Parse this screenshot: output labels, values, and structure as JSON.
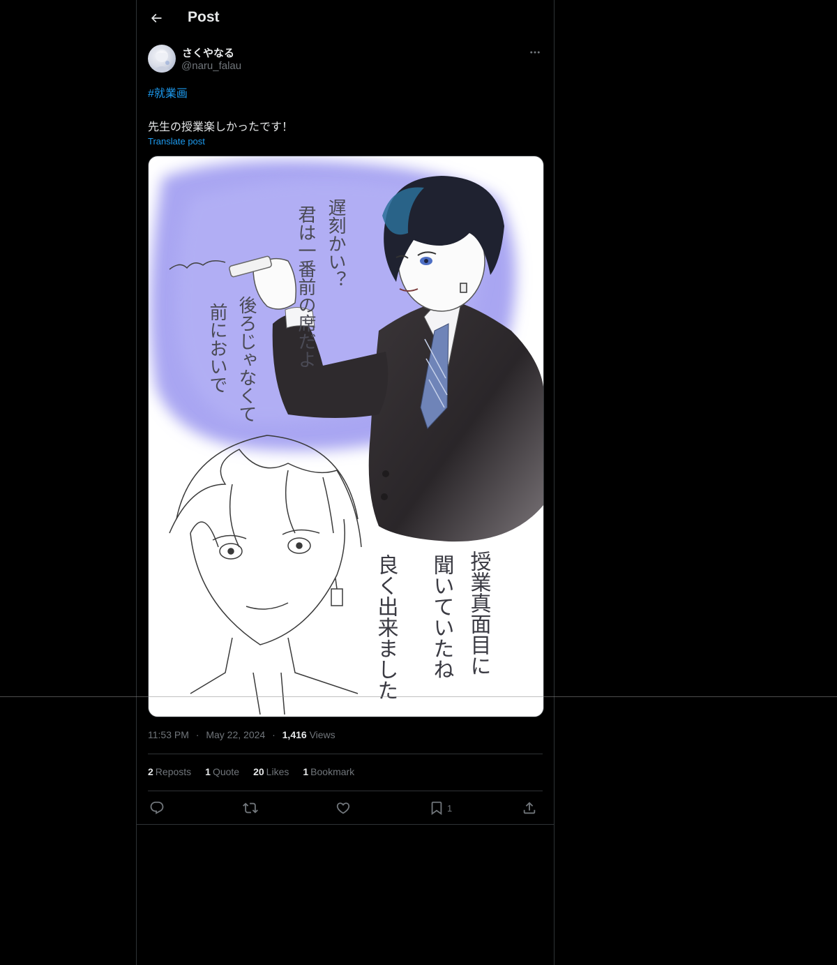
{
  "header": {
    "title": "Post",
    "back_icon": "arrow-left-icon"
  },
  "author": {
    "display_name": "さくやなる",
    "handle": "@naru_falau"
  },
  "post": {
    "hashtag": "#就業画",
    "text": "先生の授業楽しかったです！",
    "translate_label": "Translate post",
    "image_text": {
      "column_1": "遅刻かい？",
      "column_2": "君は一番前の席だよ",
      "column_3": "後ろじゃなくて",
      "column_4": "前においで",
      "column_5": "授業真面目に",
      "column_6": "聞いていたね",
      "column_7": "良く出来ました"
    }
  },
  "meta": {
    "time": "11:53 PM",
    "separator": "·",
    "date": "May 22, 2024",
    "views_count": "1,416",
    "views_label": "Views"
  },
  "stats": {
    "reposts_count": "2",
    "reposts_label": "Reposts",
    "quotes_count": "1",
    "quotes_label": "Quote",
    "likes_count": "20",
    "likes_label": "Likes",
    "bookmarks_count": "1",
    "bookmarks_label": "Bookmark"
  },
  "actions": {
    "reply_icon": "reply-icon",
    "repost_icon": "repost-icon",
    "like_icon": "heart-icon",
    "bookmark_icon": "bookmark-icon",
    "bookmark_count": "1",
    "share_icon": "share-icon"
  },
  "colors": {
    "background": "#000000",
    "text": "#e7e9ea",
    "muted": "#71767b",
    "accent": "#1d9bf0",
    "border": "#2f3336",
    "image_lavender": "#a9a6f2"
  }
}
